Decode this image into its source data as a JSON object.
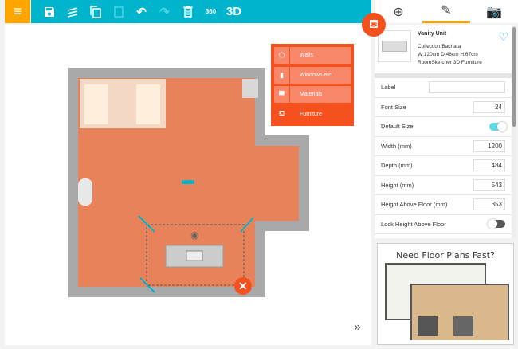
{
  "toolbar": {
    "menu_icon": "≡",
    "three_d_label": "3D",
    "icons": [
      "save-icon",
      "layers-icon",
      "copy-icon",
      "paste-icon",
      "undo-icon",
      "redo-icon",
      "trash-icon",
      "360-icon"
    ]
  },
  "right_tabs": [
    "add-icon",
    "pencil-icon",
    "camera-icon"
  ],
  "product": {
    "name": "Vanity Unit",
    "collection": "Collection:Bachata",
    "dimensions": "W:120cm D:48cm H:67cm",
    "source": "RoomSketcher 3D Furniture"
  },
  "properties": [
    {
      "label": "Label",
      "value": ""
    },
    {
      "label": "Font Size",
      "value": "24"
    },
    {
      "label": "Default Size",
      "toggle": true
    },
    {
      "label": "Width (mm)",
      "value": "1200"
    },
    {
      "label": "Depth (mm)",
      "value": "484"
    },
    {
      "label": "Height (mm)",
      "value": "543"
    },
    {
      "label": "Height Above Floor (mm)",
      "value": "353"
    },
    {
      "label": "Lock Height Above Floor",
      "toggle": false
    }
  ],
  "context_menu": [
    {
      "label": "Walls"
    },
    {
      "label": "Windows etc."
    },
    {
      "label": "Materials"
    },
    {
      "label": "Furniture"
    }
  ],
  "ad": {
    "title": "Need Floor Plans Fast?"
  },
  "colors": {
    "accent": "#00b4cc",
    "menu": "#ffa500",
    "action": "#f4511e",
    "floor": "#e8825a"
  }
}
